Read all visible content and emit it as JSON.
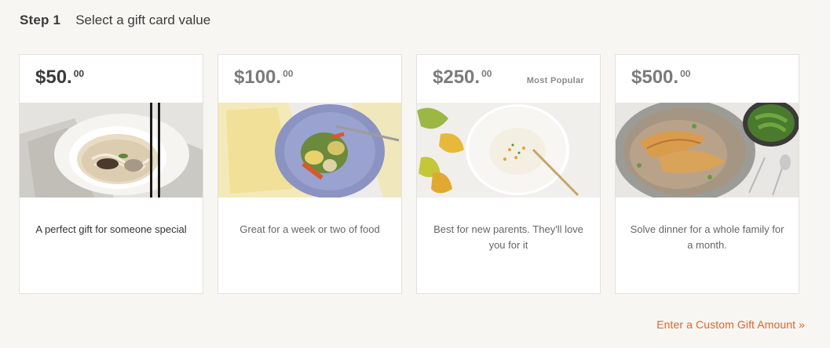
{
  "step": {
    "label": "Step 1",
    "title": "Select a gift card value"
  },
  "cards": [
    {
      "price": "$50.",
      "cents": "00",
      "badge": "",
      "description": "A perfect gift for someone special",
      "image_icon": "noodle-soup-bowl-photo",
      "selected": true
    },
    {
      "price": "$100.",
      "cents": "00",
      "badge": "",
      "description": "Great for a week or two of food",
      "image_icon": "vegetable-plate-photo",
      "selected": false
    },
    {
      "price": "$250.",
      "cents": "00",
      "badge": "Most Popular",
      "description": "Best for new parents. They'll love you for it",
      "image_icon": "soup-plate-photo",
      "selected": false
    },
    {
      "price": "$500.",
      "cents": "00",
      "badge": "",
      "description": "Solve dinner for a whole family for a month.",
      "image_icon": "fish-risotto-photo",
      "selected": false
    }
  ],
  "custom_link": "Enter a Custom Gift Amount »",
  "colors": {
    "background": "#f7f6f3",
    "link": "#e0642c",
    "card_border": "#e3e1dc"
  }
}
